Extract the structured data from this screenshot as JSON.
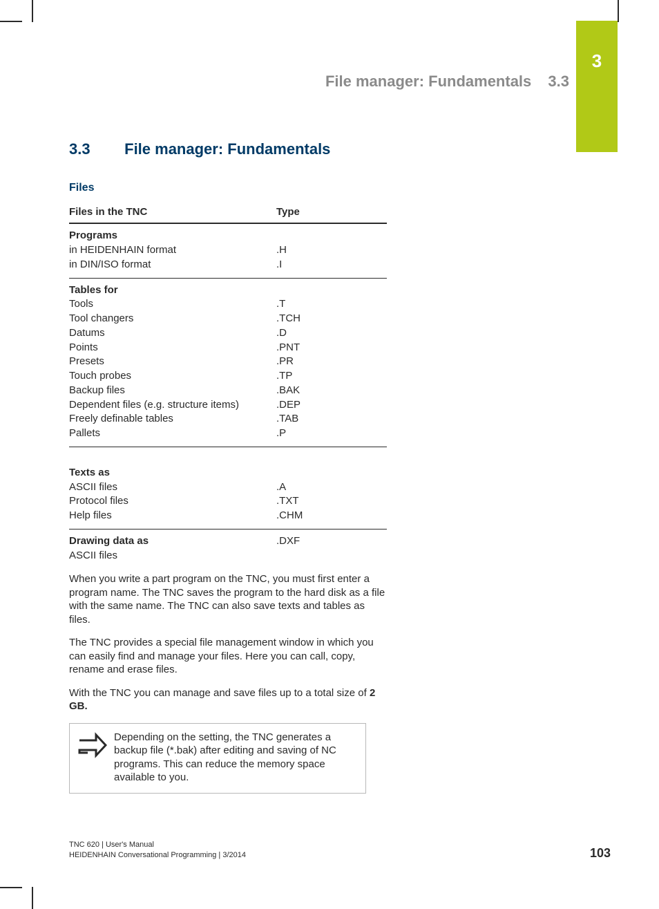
{
  "chapter_tab": "3",
  "running_head": {
    "title": "File manager: Fundamentals",
    "num": "3.3"
  },
  "section_head": {
    "num": "3.3",
    "title": "File manager: Fundamentals"
  },
  "sub_head": "Files",
  "table": {
    "head": {
      "name": "Files in the TNC",
      "type": "Type"
    },
    "groups": [
      {
        "lead": "Programs",
        "rows": [
          {
            "name": "in HEIDENHAIN format",
            "type": ".H"
          },
          {
            "name": "in DIN/ISO format",
            "type": ".I"
          }
        ]
      },
      {
        "lead": "Tables for",
        "rows": [
          {
            "name": "Tools",
            "type": ".T"
          },
          {
            "name": "Tool changers",
            "type": ".TCH"
          },
          {
            "name": "Datums",
            "type": ".D"
          },
          {
            "name": "Points",
            "type": ".PNT"
          },
          {
            "name": "Presets",
            "type": ".PR"
          },
          {
            "name": "Touch probes",
            "type": ".TP"
          },
          {
            "name": "Backup files",
            "type": ".BAK"
          },
          {
            "name": "Dependent files (e.g. structure items)",
            "type": ".DEP"
          },
          {
            "name": "Freely definable tables",
            "type": ".TAB"
          },
          {
            "name": "Pallets",
            "type": ".P"
          }
        ],
        "gap_after": true
      },
      {
        "lead": "Texts as",
        "rows": [
          {
            "name": "ASCII files",
            "type": ".A"
          },
          {
            "name": "Protocol files",
            "type": ".TXT"
          },
          {
            "name": "Help files",
            "type": ".CHM"
          }
        ]
      },
      {
        "lead": "Drawing data as",
        "lead_type": ".DXF",
        "rows": [
          {
            "name": "ASCII files",
            "type": ""
          }
        ],
        "no_rule_after": true
      }
    ]
  },
  "paragraphs": {
    "p1": "When you write a part program on the TNC, you must first enter a program name. The TNC saves the program to the hard disk as a file with the same name. The TNC can also save texts and tables as files.",
    "p2": "The TNC provides a special file management window in which you can easily find and manage your files. Here you can call, copy, rename and erase files.",
    "p3_a": "With the TNC you can manage and save files up to a total size of ",
    "p3_b": "2 GB."
  },
  "note": "Depending on the setting, the TNC generates a backup file (*.bak) after editing and saving of NC programs. This can reduce the memory space available to you.",
  "footer": {
    "line1": "TNC 620 | User's Manual",
    "line2": "HEIDENHAIN Conversational Programming | 3/2014"
  },
  "page_number": "103"
}
